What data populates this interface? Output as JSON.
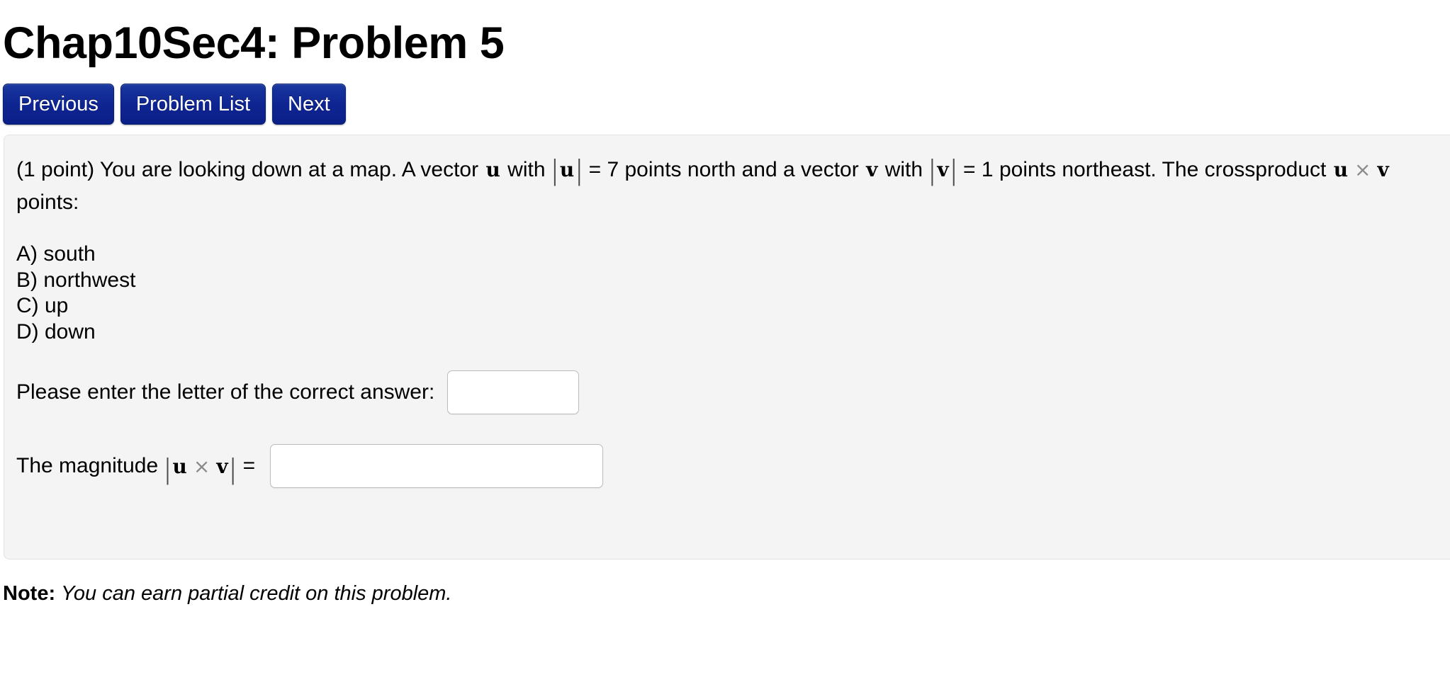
{
  "page_title": "Chap10Sec4: Problem 5",
  "nav": {
    "buttons": [
      {
        "label": "Previous",
        "name": "previous-button"
      },
      {
        "label": "Problem List",
        "name": "problem-list-button"
      },
      {
        "label": "Next",
        "name": "next-button"
      }
    ]
  },
  "problem": {
    "points": "(1 point)",
    "sentence_1a": "You are looking down at a map. A vector",
    "vector_u": "u",
    "with_1": "with",
    "bar_left": "|",
    "bar_right": "|",
    "equals": "=",
    "magnitude_u": "7",
    "points_north": "points north and a vector",
    "vector_v": "v",
    "with_2": "with",
    "magnitude_v": "1",
    "points_northeast": "points northeast. The",
    "crossproduct_word": "crossproduct",
    "cross_symbol": "×",
    "points_colon": "points:",
    "choices": [
      "A) south",
      "B) northwest",
      "C) up",
      "D) down"
    ],
    "answer_label": "Please enter the letter of the correct answer:",
    "answer_value": "",
    "answer_placeholder": "",
    "magnitude_label": "The magnitude",
    "magnitude_equals": "=",
    "magnitude_value": "",
    "magnitude_placeholder": ""
  },
  "note": {
    "label": "Note:",
    "body": "You can earn partial credit on this problem."
  },
  "colors": {
    "button_blue": "#0e2490",
    "panel_bg": "#f4f4f4",
    "panel_border": "#e3e3e3",
    "input_border": "#bdbdbd",
    "text": "#000000",
    "cross_symbol": "#8a8a8a"
  }
}
